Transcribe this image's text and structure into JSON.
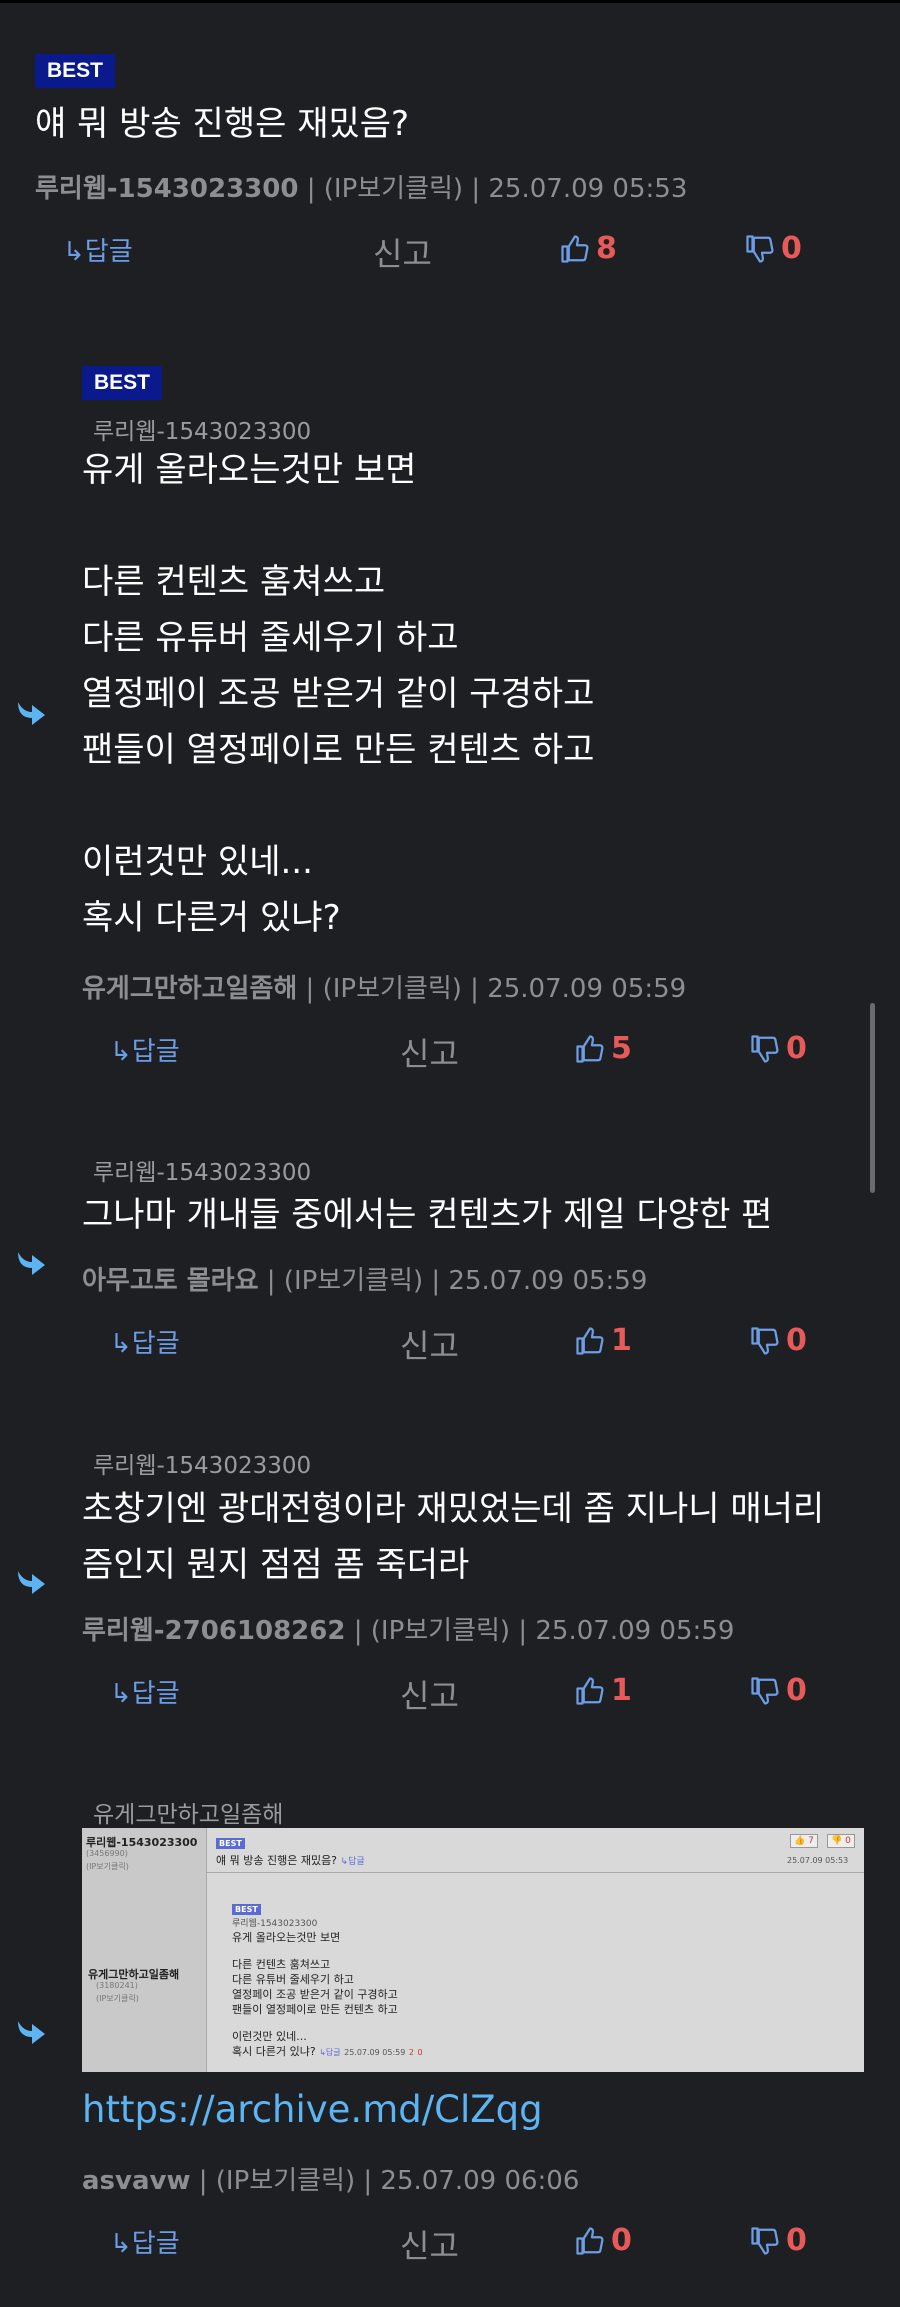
{
  "labels": {
    "best": "BEST",
    "ip_click": "(IP보기클릭)",
    "reply": "↳답글",
    "report": "신고"
  },
  "comments": [
    {
      "body": "얘 뭐 방송 진행은 재밌음?",
      "author": "루리웹-1543023300",
      "time": "25.07.09 05:53",
      "likes": "8",
      "dislikes": "0"
    },
    {
      "reply_to": "루리웹-1543023300",
      "body": "유게 올라오는것만 보면\n\n다른 컨텐츠 훔쳐쓰고\n다른 유튜버 줄세우기 하고\n열정페이 조공 받은거 같이 구경하고\n팬들이 열정페이로 만든 컨텐츠 하고\n\n이런것만 있네...\n혹시 다른거 있냐?",
      "author": "유게그만하고일좀해",
      "time": "25.07.09 05:59",
      "likes": "5",
      "dislikes": "0"
    },
    {
      "reply_to": "루리웹-1543023300",
      "body": "그나마 개내들 중에서는 컨텐츠가 제일 다양한 편",
      "author": "아무고토 몰라요",
      "time": "25.07.09 05:59",
      "likes": "1",
      "dislikes": "0"
    },
    {
      "reply_to": "루리웹-1543023300",
      "body": "초창기엔 광대전형이라 재밌었는데 좀 지나니 매너리\n즘인지 뭔지 점점 폼 죽더라",
      "author": "루리웹-2706108262",
      "time": "25.07.09 05:59",
      "likes": "1",
      "dislikes": "0"
    },
    {
      "reply_to": "유게그만하고일좀해",
      "link": "https://archive.md/ClZqg",
      "author": "asvavw",
      "time": "25.07.09 06:06",
      "likes": "0",
      "dislikes": "0"
    }
  ],
  "thumbnail": {
    "author1": "루리웹-1543023300",
    "author1_sub1": "(3456990)",
    "author1_sub2": "(IP보기클릭)",
    "post_text": "얘 뭐 방송 진행은 재밌음?",
    "reply_tag": "↳답글",
    "up": "7",
    "down": "0",
    "time1": "25.07.09 05:53",
    "best": "BEST",
    "reply_to": "루리웹-1543023300",
    "author2": "유게그만하고일좀해",
    "author2_sub1": "(3180241)",
    "author2_sub2": "(IP보기클릭)",
    "lines": [
      "유게 올라오는것만 보면",
      "다른 컨텐츠 훔쳐쓰고",
      "다른 유튜버 줄세우기 하고",
      "열정페이 조공 받은거 같이 구경하고",
      "팬들이 열정페이로 만든 컨텐츠 하고",
      "이런것만 있네...",
      "혹시 다른거 있냐?"
    ],
    "footer_time": "25.07.09 05:59",
    "footer_up": "2",
    "footer_down": "0"
  },
  "colors": {
    "background": "#1e1f23",
    "badge": "#0a1a8c",
    "count": "#e65a5a",
    "accent": "#6d9de4",
    "link": "#5db4f3"
  }
}
